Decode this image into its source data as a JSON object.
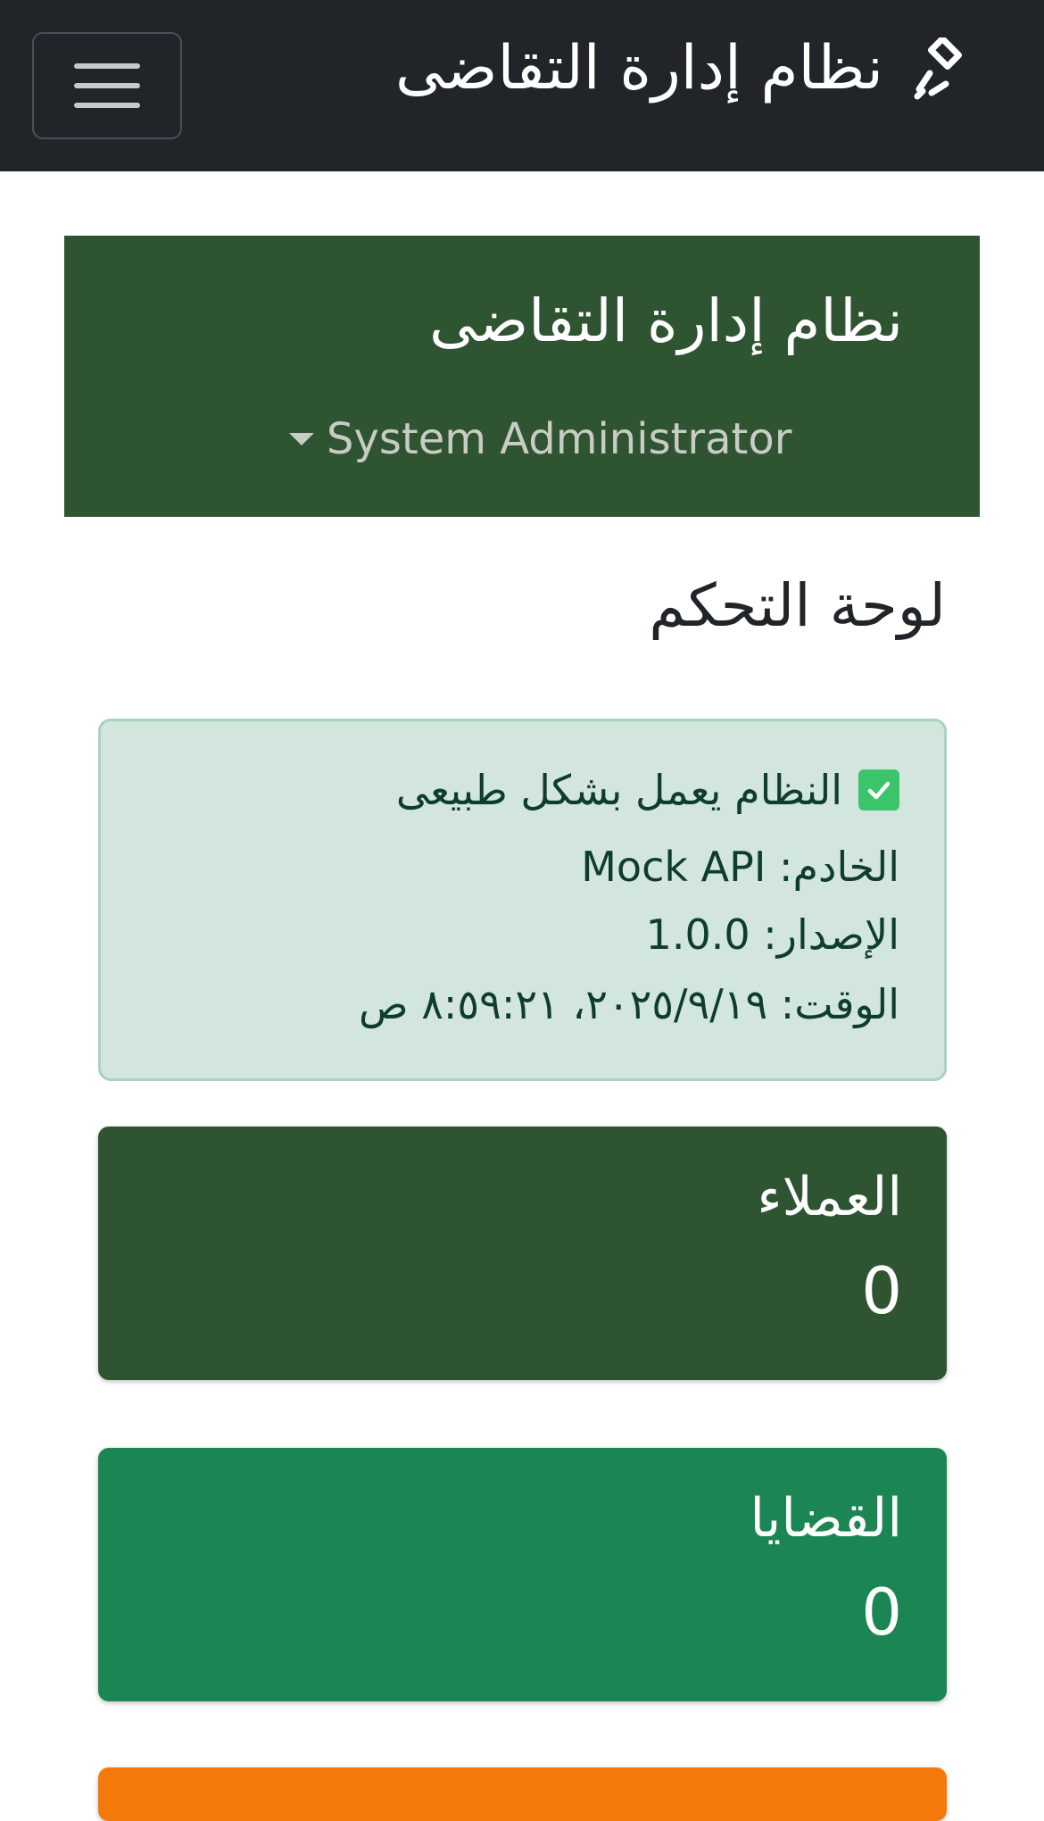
{
  "navbar": {
    "brand_title": "نظام إدارة التقاضى",
    "brand_icon": "gavel-icon",
    "menu_icon": "hamburger-menu-icon",
    "background": "#212529"
  },
  "sidebar": {
    "title": "نظام إدارة التقاضى",
    "user_name": "System Administrator",
    "background": "#2f5432"
  },
  "main": {
    "page_title": "لوحة التحكم",
    "status_alert": {
      "message": "النظام يعمل بشكل طبيعى",
      "server_line": "الخادم: Mock API",
      "version_line": "الإصدار: 1.0.0",
      "time_line": "الوقت: ٢٠٢٥/٩/١٩، ٨:٥٩:٢١ ص",
      "icon": "check-icon",
      "background": "#d2e6dd"
    },
    "stats": [
      {
        "label": "العملاء",
        "value": "0",
        "color": "#2f5432"
      },
      {
        "label": "القضايا",
        "value": "0",
        "color": "#1b8653"
      },
      {
        "label": "",
        "value": "",
        "color": "#f5780b"
      }
    ]
  }
}
